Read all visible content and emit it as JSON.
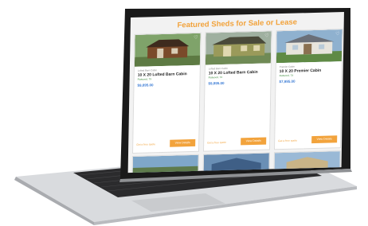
{
  "page": {
    "title": "Featured Sheds for Sale or Lease"
  },
  "cards": [
    {
      "category": "Lofted Barn Cabin",
      "name": "10 X 20 Lofted Barn Cabin",
      "location": "Flatwood, TX",
      "price": "$9,895.00",
      "cta": "View Details",
      "link": "Get a free quote"
    },
    {
      "category": "Lofted Barn Cabin",
      "name": "10 X 20 Lofted Barn Cabin",
      "location": "Flatwood, TX",
      "price": "$9,895.00",
      "cta": "View Details",
      "link": "Get a free quote"
    },
    {
      "category": "Premier Cabin",
      "name": "10 X 20 Premier Cabin",
      "location": "Flatwood, TX",
      "price": "$7,995.00",
      "cta": "View Details",
      "link": "Get a free quote"
    }
  ],
  "colors": {
    "accent": "#f2a33c",
    "price": "#3a7bd5",
    "laptop_body": "#d9dbde",
    "bezel": "#1a1a1a"
  }
}
